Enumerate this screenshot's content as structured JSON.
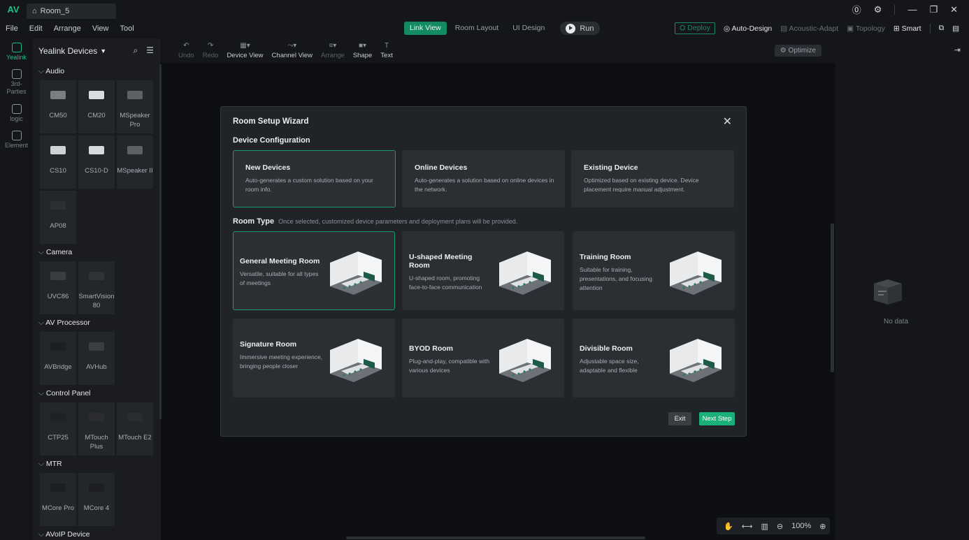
{
  "titlebar": {
    "logo": "AV",
    "tab": "Room_5"
  },
  "menu": {
    "file": "File",
    "edit": "Edit",
    "arrange": "Arrange",
    "view": "View",
    "tool": "Tool"
  },
  "modes": {
    "link_view": "Link View",
    "room_layout": "Room Layout",
    "ui_design": "UI Design",
    "run": "Run"
  },
  "right_menu": {
    "deploy": "Deploy",
    "auto_design": "Auto-Design",
    "acoustic": "Acoustic-Adapt",
    "topology": "Topology",
    "smart": "Smart"
  },
  "iconbar": {
    "yealink": "Yealink",
    "third": "3rd-Parties",
    "logic": "logic",
    "element": "Element"
  },
  "sidepanel": {
    "title": "Yealink Devices",
    "categories": [
      {
        "name": "Audio",
        "devices": [
          "CM50",
          "CM20",
          "MSpeaker Pro",
          "CS10",
          "CS10-D",
          "MSpeaker II",
          "AP08"
        ]
      },
      {
        "name": "Camera",
        "devices": [
          "UVC86",
          "SmartVision 80"
        ]
      },
      {
        "name": "AV Processor",
        "devices": [
          "AVBridge",
          "AVHub"
        ]
      },
      {
        "name": "Control Panel",
        "devices": [
          "CTP25",
          "MTouch Plus",
          "MTouch E2"
        ]
      },
      {
        "name": "MTR",
        "devices": [
          "MCore Pro",
          "MCore 4"
        ]
      },
      {
        "name": "AVoIP Device",
        "devices": []
      }
    ]
  },
  "toolbar": {
    "undo": "Undo",
    "redo": "Redo",
    "device_view": "Device View",
    "channel_view": "Channel View",
    "arrange": "Arrange",
    "shape": "Shape",
    "text": "Text",
    "optimize": "Optimize"
  },
  "rightpanel": {
    "empty": "No data"
  },
  "bottom": {
    "zoom": "100%"
  },
  "modal": {
    "title": "Room Setup Wizard",
    "device_config": "Device Configuration",
    "config_cards": [
      {
        "title": "New Devices",
        "desc": "Auto-generates a custom solution based on your room info."
      },
      {
        "title": "Online Devices",
        "desc": "Auto-generates a solution based on online devices in the network."
      },
      {
        "title": "Existing Device",
        "desc": "Optimized based on existing device. Device placement require manual adjustment."
      }
    ],
    "room_type": "Room Type",
    "room_type_sub": "Once selected, customized device parameters and deployment plans will be provided.",
    "room_cards": [
      {
        "title": "General Meeting Room",
        "desc": "Versatile, suitable for all types of meetings"
      },
      {
        "title": "U-shaped Meeting Room",
        "desc": "U-shaped room, promoting face-to-face communication"
      },
      {
        "title": "Training Room",
        "desc": "Suitable for training, presentations, and focusing attention"
      },
      {
        "title": "Signature Room",
        "desc": "Immersive meeting experience, bringing people closer"
      },
      {
        "title": "BYOD Room",
        "desc": "Plug-and-play, compatible with various devices"
      },
      {
        "title": "Divisible Room",
        "desc": "Adjustable space size, adaptable and flexible"
      }
    ],
    "exit": "Exit",
    "next": "Next Step"
  },
  "colors": {
    "accent": "#1bb07a",
    "bg": "#0d0f12"
  }
}
